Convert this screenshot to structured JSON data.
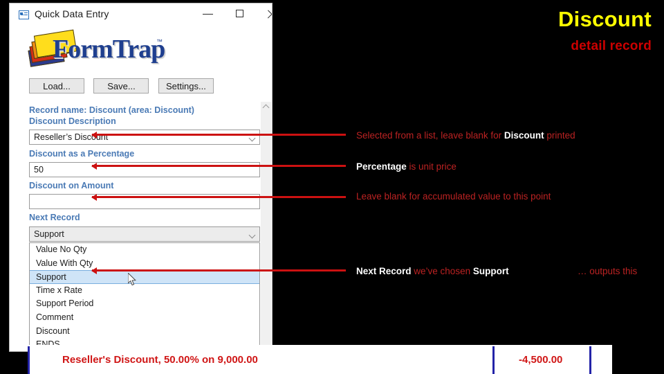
{
  "slide": {
    "title": "Discount",
    "subtitle": "detail record",
    "title_color": "#ffff00",
    "subtitle_color": "#cc0000",
    "background_color": "#000000"
  },
  "dialog": {
    "titlebar": {
      "icon": "form-window-icon",
      "title": "Quick Data Entry",
      "minimize": "minimize-icon",
      "maximize": "maximize-icon",
      "close": "close-icon"
    },
    "logo": {
      "word": "FormTrap",
      "trademark": "™",
      "sheet_colors": [
        "#ffdd1c",
        "#f08a14",
        "#d32c18",
        "#2b3a8c"
      ],
      "word_color": "#1f3f8f"
    },
    "buttons": [
      {
        "label": "Load..."
      },
      {
        "label": "Save..."
      },
      {
        "label": "Settings..."
      }
    ],
    "record_header": "Record name:  Discount (area:  Discount)",
    "label_color": "#4a7ab5",
    "fields": [
      {
        "label": "Discount  Description",
        "value": "Reseller’s Discount",
        "type": "combo"
      },
      {
        "label": "Discount as a  Percentage",
        "value": "50",
        "type": "text"
      },
      {
        "label": "Discount on  Amount",
        "value": "",
        "type": "text"
      },
      {
        "label": "Next  Record",
        "value": "Support",
        "type": "combo"
      }
    ],
    "dropdown": {
      "selected": "Support",
      "options": [
        "Value No Qty",
        "Value With Qty",
        "Support",
        "Time x Rate",
        "Support Period",
        "Comment",
        "Discount",
        "ENDS"
      ],
      "highlight_color": "#cfe4f7"
    },
    "scrollbar": {
      "up_arrow": "scroll-up-icon"
    },
    "cursor": "mouse-pointer-icon"
  },
  "notes": [
    {
      "parts": [
        {
          "text": "Selected from a list, leave blank for ",
          "style": "red"
        },
        {
          "text": "Discount",
          "style": "white"
        },
        {
          "text": " printed",
          "style": "red"
        }
      ]
    },
    {
      "parts": [
        {
          "text": "Percentage",
          "style": "white"
        },
        {
          "text": "  is unit price",
          "style": "red"
        }
      ]
    },
    {
      "parts": [
        {
          "text": "Leave blank for accumulated value to this point",
          "style": "red"
        }
      ]
    },
    {
      "parts": [
        {
          "text": "Next Record",
          "style": "white"
        },
        {
          "text": "  we’ve chosen ",
          "style": "red"
        },
        {
          "text": "Support",
          "style": "white"
        }
      ]
    }
  ],
  "note_tail": "… outputs this",
  "output_strip": {
    "description": "Reseller's Discount, 50.00% on 9,000.00",
    "amount": "-4,500.00",
    "text_color": "#d01616",
    "divider_color": "#2323a8"
  }
}
